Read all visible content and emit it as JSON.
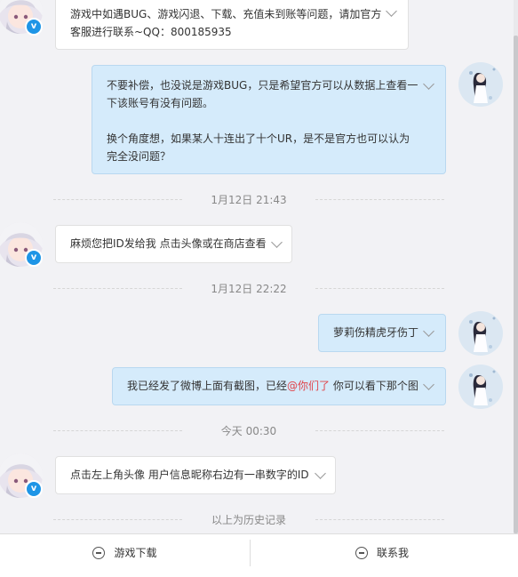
{
  "messages": [
    {
      "side": "left",
      "text": "游戏中如遇BUG、游戏闪退、下载、充值未到账等问题，请加官方\n客服进行联系~QQ：800185935"
    },
    {
      "side": "right",
      "text": "不要补偿，也没说是游戏BUG，只是希望官方可以从数据上查看一\n下该账号有没有问题。\n\n换个角度想，如果某人十连出了十个UR，是不是官方也可以认为\n完全没问题？"
    },
    {
      "side": "left",
      "text": "麻烦您把ID发给我 点击头像或在商店查看"
    },
    {
      "side": "right",
      "text": "萝莉伤精虎牙伤丁"
    },
    {
      "side": "right",
      "before": "我已经发了微博上面有截图，已经",
      "mention": "@你们了",
      "after": " 你可以看下那个图"
    },
    {
      "side": "left",
      "text": "点击左上角头像 用户信息昵称右边有一串数字的ID"
    }
  ],
  "timestamps": [
    "1月12日 21:43",
    "1月12日 22:22",
    "今天 00:30"
  ],
  "history_label": "以上为历史记录",
  "footer": {
    "download": "游戏下载",
    "contact": "联系我"
  },
  "badge": "v",
  "colors": {
    "mention": "#e0444a",
    "right_bubble": "#d5ebfb",
    "left_bubble": "#ffffff",
    "badge": "#1e95e6"
  }
}
